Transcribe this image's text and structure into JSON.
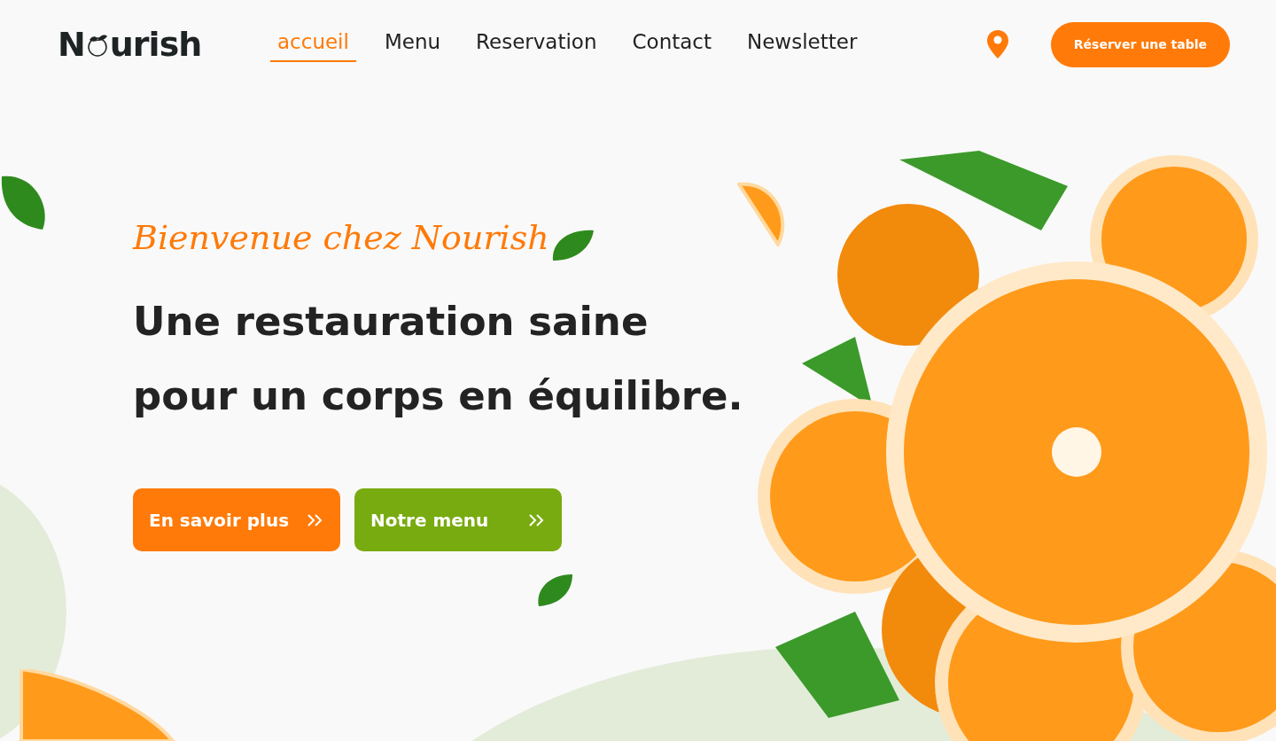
{
  "logo": {
    "before": "N",
    "after": "urish"
  },
  "nav": [
    {
      "label": "accueil",
      "selected": true
    },
    {
      "label": "Menu",
      "selected": false
    },
    {
      "label": "Reservation",
      "selected": false
    },
    {
      "label": "Contact",
      "selected": false
    },
    {
      "label": "Newsletter",
      "selected": false
    }
  ],
  "reserve_button": "Réserver une table",
  "hero": {
    "welcome": "Bienvenue chez Nourish",
    "headline": [
      "Une restauration saine",
      "pour un corps en équilibre."
    ],
    "buttons": [
      {
        "label": "En savoir plus",
        "kind": "primary"
      },
      {
        "label": "Notre menu",
        "kind": "secondary"
      }
    ]
  }
}
